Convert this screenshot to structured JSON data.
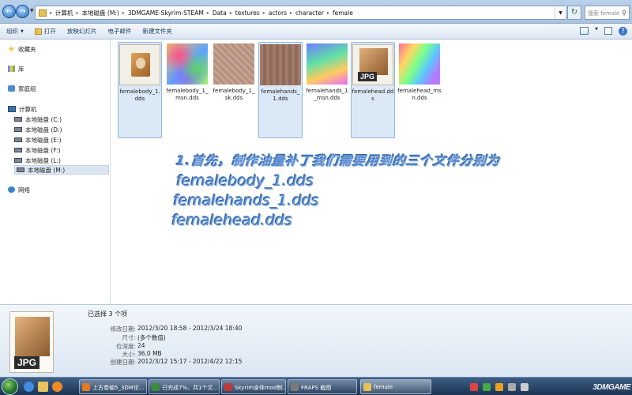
{
  "address_bar": {
    "crumbs": [
      "计算机",
      "本地磁盘 (M:)",
      "3DMGAME-Skyrim-STEAM",
      "Data",
      "textures",
      "actors",
      "character",
      "female"
    ],
    "search_placeholder": "搜索 female"
  },
  "toolbar": {
    "organize": "组织",
    "open": "打开",
    "slideshow": "放映幻灯片",
    "email": "电子邮件",
    "new_folder": "新建文件夹"
  },
  "sidebar": {
    "favorites": "收藏夹",
    "libraries": "库",
    "homegroup": "家庭组",
    "computer": "计算机",
    "drives": [
      "本地磁盘 (C:)",
      "本地磁盘 (D:)",
      "本地磁盘 (E:)",
      "本地磁盘 (F:)",
      "本地磁盘 (L:)",
      "本地磁盘 (M:)"
    ],
    "network": "网络"
  },
  "files": [
    {
      "name": "femalebody_1.dds",
      "selected": true
    },
    {
      "name": "femalebody_1_msn.dds",
      "selected": false
    },
    {
      "name": "femalebody_1_sk.dds",
      "selected": false
    },
    {
      "name": "femalehands_1.dds",
      "selected": true
    },
    {
      "name": "femalehands_1_msn.dds",
      "selected": false
    },
    {
      "name": "femalehead.dds",
      "selected": true,
      "badge": "JPG"
    },
    {
      "name": "femalehead_msn.dds",
      "selected": false
    }
  ],
  "overlay": {
    "line1": "1.首先，制作油量补丁我们需要用到的三个文件分别为",
    "line2": "femalebody_1.dds",
    "line3": "femalehands_1.dds",
    "line4": "femalehead.dds"
  },
  "details": {
    "badge": "JPG",
    "title": "已选择 3 个项",
    "rows": [
      {
        "key": "修改日期:",
        "value": "2012/3/20 18:58 - 2012/3/24 18:40"
      },
      {
        "key": "尺寸:",
        "value": "(多个数值)"
      },
      {
        "key": "位深度:",
        "value": "24"
      },
      {
        "key": "大小:",
        "value": "36.0 MB"
      },
      {
        "key": "创建日期:",
        "value": "2012/3/12 15:17 - 2012/4/22 12:15"
      }
    ]
  },
  "taskbar": {
    "tasks": [
      "上古卷轴5_3DM论...",
      "已完成7%，共1个文...",
      "Skyrim身体mod制...",
      "FRAPS 截图",
      "female"
    ],
    "tray_logo": "3DMGAME"
  }
}
